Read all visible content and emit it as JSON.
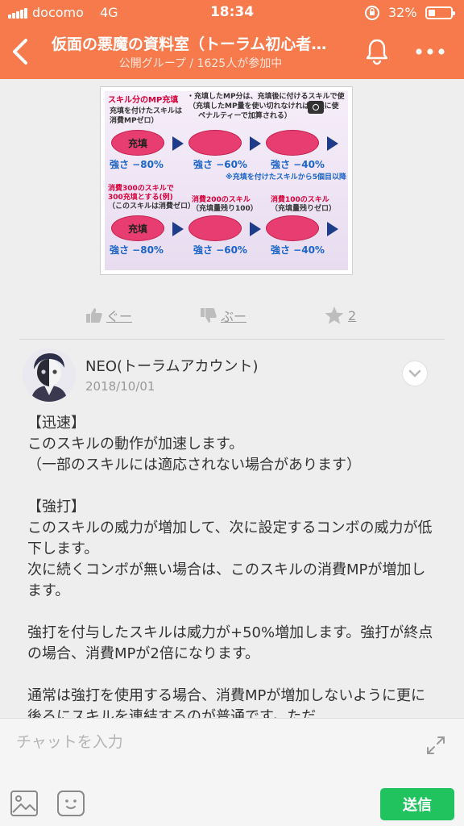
{
  "status_bar": {
    "carrier": "docomo",
    "network": "4G",
    "time": "18:34",
    "battery_percent": "32%",
    "battery_level": 0.32
  },
  "header": {
    "title": "仮面の悪魔の資料室（トーラム初心者…",
    "subtitle": "公開グループ / 1625人が参加中",
    "background_color": "#f77a4c"
  },
  "attachment": {
    "line1": "スキル分のMP充填",
    "line2": "・充填したMP分は、充填後に付けるスキルで使",
    "line3": "（充填したMP量を使い切れなければ、後に使",
    "line4": "ペナルティーで加算される）",
    "box1": "充填を付けたスキルは",
    "box2": "消費MPゼロ）",
    "oval_label": "充填",
    "strength_row1": [
      "強さ −80%",
      "強さ −60%",
      "強さ −40%"
    ],
    "note": "※充填を付けたスキルから5個目以降",
    "lower_left1": "消費300のスキルで",
    "lower_left2": "300充填とする(例)",
    "lower_left3": "（このスキルは消費ゼロ）",
    "lower_mid1": "消費200のスキル",
    "lower_mid2": "（充填量残り100）",
    "lower_right1": "消費100のスキル",
    "lower_right2": "（充填量残りゼロ）",
    "strength_row2": [
      "強さ −80%",
      "強さ −60%",
      "強さ −40%"
    ]
  },
  "actions": {
    "like_label": "ぐー",
    "dislike_label": "ぶー",
    "star_count": "2"
  },
  "post": {
    "author": "NEO(トーラムアカウント)",
    "date": "2018/10/01",
    "paragraphs": [
      "【迅速】\nこのスキルの動作が加速します。\n（一部のスキルには適応されない場合があります）",
      "【強打】\nこのスキルの威力が増加して、次に設定するコンボの威力が低下します。\n次に続くコンボが無い場合は、このスキルの消費MPが増加します。",
      "強打を付与したスキルは威力が+50%増加します。強打が終点の場合、消費MPが2倍になります。",
      "通常は強打を使用する場合、消費MPが増加しないように更に後ろにスキルを連結するのが普通です。ただ"
    ]
  },
  "input": {
    "placeholder": "チャットを入力",
    "send_label": "送信",
    "send_color": "#20c35e"
  }
}
